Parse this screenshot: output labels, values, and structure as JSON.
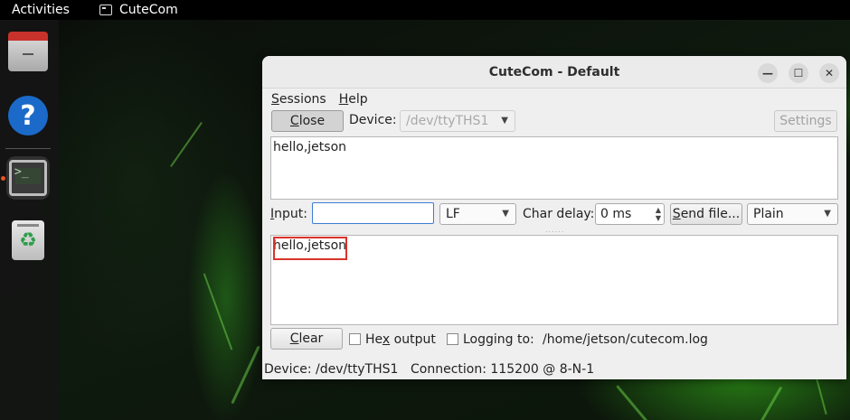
{
  "topbar": {
    "activities": "Activities",
    "app_name": "CuteCom"
  },
  "dock": {
    "items": [
      {
        "name": "Files"
      },
      {
        "name": "Help"
      },
      {
        "name": "CuteCom",
        "glyph": ">_"
      },
      {
        "name": "Trash"
      }
    ]
  },
  "window": {
    "title": "CuteCom - Default",
    "menu": [
      {
        "label_u": "S",
        "label_rest": "essions"
      },
      {
        "label_u": "H",
        "label_rest": "elp"
      }
    ],
    "close_button_u": "C",
    "close_button_rest": "lose",
    "device_label": "Device:",
    "device_value": "/dev/ttyTHS1",
    "settings_button": "Settings",
    "top_output": "hello,jetson",
    "input_label_u": "I",
    "input_label_rest": "nput:",
    "input_value": "",
    "line_end": "LF",
    "char_delay_label": "Char delay:",
    "char_delay_value": "0 ms",
    "send_file_u": "S",
    "send_file_rest": "end file...",
    "format": "Plain",
    "output_text": "hello,jetson",
    "clear_u": "C",
    "clear_rest": "lear",
    "hex_pre": "He",
    "hex_u": "x",
    "hex_post": " output",
    "logging_label": "Logging to:",
    "logging_path": "/home/jetson/cutecom.log",
    "status_device": "Device:  /dev/ttyTHS1",
    "status_connection": "Connection:  115200 @ 8-N-1"
  },
  "colors": {
    "highlight": "#d9342b",
    "input_focus": "#3d7bd4",
    "dock_indicator": "#e95420"
  }
}
